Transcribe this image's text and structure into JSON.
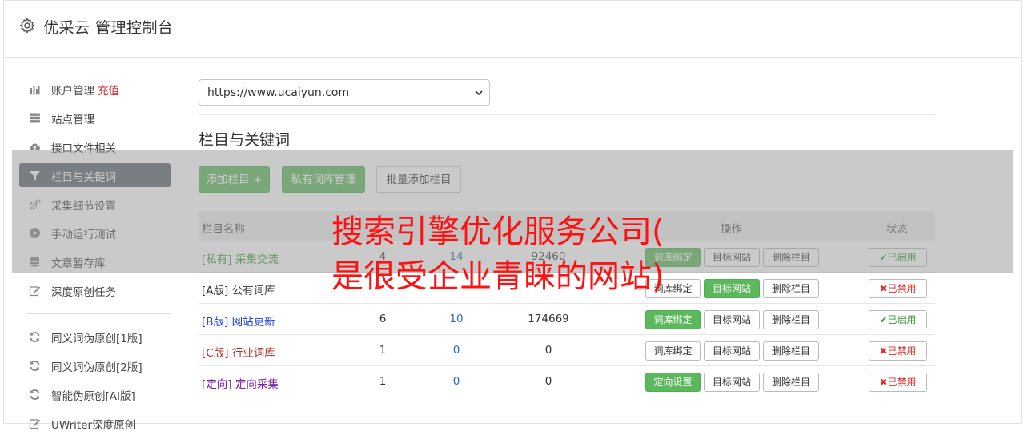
{
  "app": {
    "title": "优采云 管理控制台"
  },
  "sidebar": {
    "items": [
      {
        "label": "账户管理",
        "extra": "充值",
        "icon": "bar-chart-icon",
        "active": false
      },
      {
        "label": "站点管理",
        "icon": "server-icon",
        "active": false
      },
      {
        "label": "接口文件相关",
        "icon": "cloud-upload-icon",
        "active": false
      },
      {
        "label": "栏目与关键词",
        "icon": "filter-icon",
        "active": true
      },
      {
        "label": "采集细节设置",
        "icon": "cogs-icon",
        "active": false
      },
      {
        "label": "手动运行测试",
        "icon": "play-circle-icon",
        "active": false
      },
      {
        "label": "文章暂存库",
        "icon": "database-icon",
        "active": false
      },
      {
        "label": "深度原创任务",
        "icon": "edit-icon",
        "active": false
      }
    ],
    "items2": [
      {
        "label": "同义词伪原创[1版]",
        "icon": "refresh-icon"
      },
      {
        "label": "同义词伪原创[2版]",
        "icon": "refresh-icon"
      },
      {
        "label": "智能伪原创[AI版]",
        "icon": "refresh-icon"
      },
      {
        "label": "UWriter深度原创",
        "icon": "edit-icon"
      }
    ]
  },
  "site_select": {
    "value": "https://www.ucaiyun.com"
  },
  "section": {
    "title": "栏目与关键词"
  },
  "toolbar": {
    "add_label": "添加栏目 +",
    "private_lib_label": "私有词库管理",
    "batch_add_label": "批量添加栏目"
  },
  "table": {
    "headers": {
      "name": "栏目名称",
      "col2": "",
      "col3": "",
      "col4": "",
      "ops": "操作",
      "status": "状态"
    },
    "rows": [
      {
        "tag": "[私有]",
        "name": "采集交流",
        "a": "4",
        "b": "14",
        "c": "92460",
        "op1": "词库绑定",
        "op1_green": true,
        "op2": "目标网站",
        "op2_green": false,
        "op3": "删除栏目",
        "status": "已启用",
        "enabled": true,
        "color": "#3a9a3a"
      },
      {
        "tag": "[A版]",
        "name": "公有词库",
        "a": "",
        "b": "",
        "c": "",
        "op1": "词库绑定",
        "op1_green": false,
        "op2": "目标网站",
        "op2_green": true,
        "op3": "删除栏目",
        "status": "已禁用",
        "enabled": false,
        "color": "#333333"
      },
      {
        "tag": "[B版]",
        "name": "网站更新",
        "a": "6",
        "b": "10",
        "c": "174669",
        "op1": "词库绑定",
        "op1_green": true,
        "op2": "目标网站",
        "op2_green": false,
        "op3": "删除栏目",
        "status": "已启用",
        "enabled": true,
        "color": "#1a3fd6"
      },
      {
        "tag": "[C版]",
        "name": "行业词库",
        "a": "1",
        "b": "0",
        "c": "0",
        "op1": "词库绑定",
        "op1_green": false,
        "op2": "目标网站",
        "op2_green": false,
        "op3": "删除栏目",
        "status": "已禁用",
        "enabled": false,
        "color": "#b02a2a"
      },
      {
        "tag": "[定向]",
        "name": "定向采集",
        "a": "1",
        "b": "0",
        "c": "0",
        "op1": "定向设置",
        "op1_green": true,
        "op2": "目标网站",
        "op2_green": false,
        "op3": "删除栏目",
        "status": "已禁用",
        "enabled": false,
        "color": "#7a1fb0"
      }
    ]
  },
  "overlay": {
    "line1": "搜索引擎优化服务公司(",
    "line2": "是很受企业青睐的网站)"
  }
}
